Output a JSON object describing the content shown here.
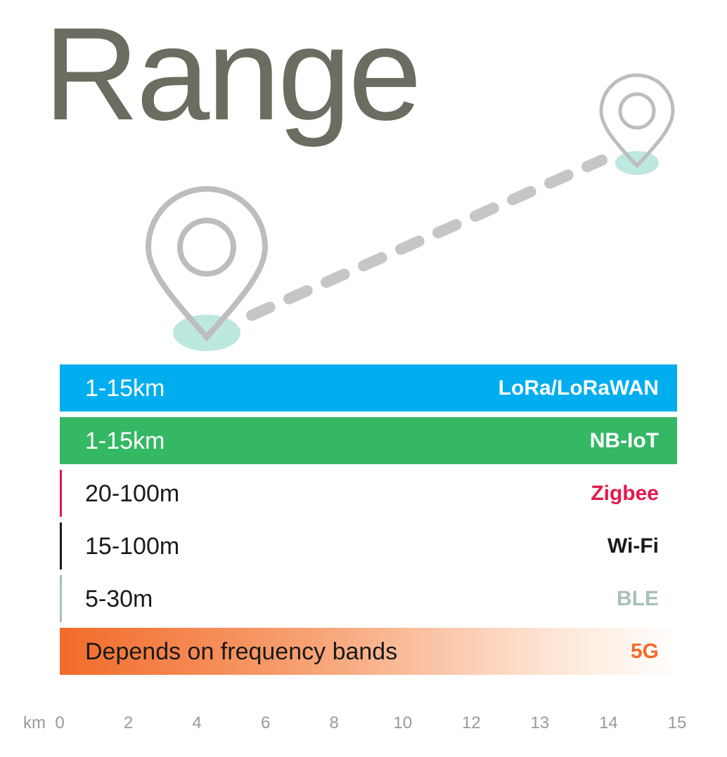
{
  "title": "Range",
  "colors": {
    "title": "#6d6c61",
    "pin": "#bdbdbd",
    "pin_shadow": "#bde8df",
    "dash": "#c6c6c6",
    "axis_text": "#9a9a9a"
  },
  "icons": [
    "location-pin-icon",
    "location-pin-icon",
    "dashed-route-line"
  ],
  "chart_data": {
    "type": "bar",
    "title": "Range",
    "orientation": "horizontal",
    "x_axis": {
      "unit": "km",
      "tick_labels": [
        "0",
        "2",
        "4",
        "6",
        "8",
        "10",
        "12",
        "13",
        "14",
        "15"
      ]
    },
    "series": [
      {
        "tech": "LoRa/LoRaWAN",
        "range": "1-15km",
        "color": "#00aeef",
        "tech_color": "#ffffff",
        "range_color": "#ffffff",
        "style": "solid"
      },
      {
        "tech": "NB-IoT",
        "range": "1-15km",
        "color": "#35b864",
        "tech_color": "#ffffff",
        "range_color": "#ffffff",
        "style": "solid"
      },
      {
        "tech": "Zigbee",
        "range": "20-100m",
        "color": "#e2194c",
        "tech_color": "#e2194c",
        "range_color": "#1a1a1a",
        "style": "line"
      },
      {
        "tech": "Wi-Fi",
        "range": "15-100m",
        "color": "#1a1a1a",
        "tech_color": "#1a1a1a",
        "range_color": "#1a1a1a",
        "style": "line"
      },
      {
        "tech": "BLE",
        "range": "5-30m",
        "color": "#a9bfbb",
        "tech_color": "#a9bfbb",
        "range_color": "#1a1a1a",
        "style": "line"
      },
      {
        "tech": "5G",
        "range": "Depends on frequency bands",
        "color": "#f26b2b",
        "tech_color": "#f26b2b",
        "range_color": "#1a1a1a",
        "style": "gradient"
      }
    ]
  }
}
